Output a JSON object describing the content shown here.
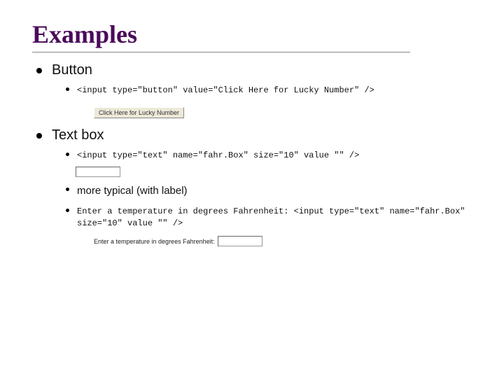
{
  "title": "Examples",
  "items": [
    {
      "heading": "Button",
      "sub": [
        {
          "kind": "code",
          "text": "<input type=\"button\" value=\"Click Here for Lucky Number\" />"
        }
      ],
      "render": {
        "kind": "button",
        "label": "Click Here for Lucky Number"
      }
    },
    {
      "heading": "Text box",
      "sub": [
        {
          "kind": "code",
          "text": "<input type=\"text\" name=\"fahr.Box\" size=\"10\" value \"\" />"
        },
        {
          "kind": "render-textbox"
        },
        {
          "kind": "text",
          "text": "more typical (with label)"
        },
        {
          "kind": "code",
          "text": "Enter a temperature in degrees Fahrenheit: <input type=\"text\" name=\"fahr.Box\" size=\"10\" value \"\" />"
        }
      ],
      "render2": {
        "kind": "labeled-textbox",
        "label": "Enter a temperature in degrees Fahrenheit:"
      }
    }
  ]
}
